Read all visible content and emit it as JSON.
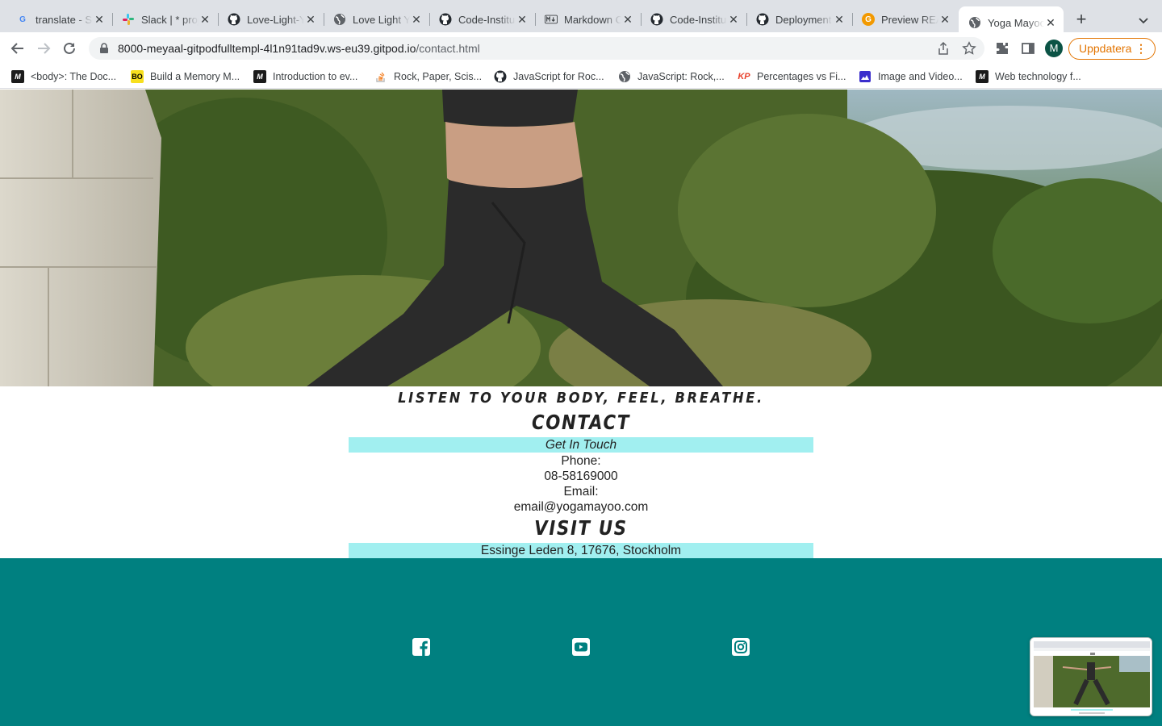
{
  "browser": {
    "tabs": [
      {
        "title": "translate - Sök på Google",
        "icon": "google-icon",
        "color": "#4285f4"
      },
      {
        "title": "Slack | * project",
        "icon": "slack-icon",
        "color": "#e01e5a"
      },
      {
        "title": "Love-Light-Yoga",
        "icon": "github-icon",
        "color": "#24292f"
      },
      {
        "title": "Love Light Yoga",
        "icon": "globe-icon",
        "color": "#5f6368"
      },
      {
        "title": "Code-Institute-Org",
        "icon": "github-icon",
        "color": "#24292f"
      },
      {
        "title": "Markdown Cheatsheet",
        "icon": "markdown-icon",
        "color": "#3c4043"
      },
      {
        "title": "Code-Institute-Solutions",
        "icon": "github-icon",
        "color": "#24292f"
      },
      {
        "title": "Deployment",
        "icon": "github-icon",
        "color": "#24292f"
      },
      {
        "title": "Preview README",
        "icon": "preview-icon",
        "color": "#f29900"
      },
      {
        "title": "Yoga Mayoo",
        "icon": "globe-icon",
        "color": "#5f6368"
      }
    ],
    "active_tab": 9,
    "url_host": "8000-meyaal-gitpodfulltempl-4l1n91tad9v.ws-eu39.gitpod.io",
    "url_path": "/contact.html",
    "profile_initial": "M",
    "update_label": "Uppdatera",
    "bookmarks": [
      {
        "label": "<body>: The Doc...",
        "icon": "mdn-icon"
      },
      {
        "label": "Build a Memory M...",
        "icon": "bo-icon"
      },
      {
        "label": "Introduction to ev...",
        "icon": "mdn-icon"
      },
      {
        "label": "Rock, Paper, Scis...",
        "icon": "stackoverflow-icon"
      },
      {
        "label": "JavaScript for Roc...",
        "icon": "github-icon"
      },
      {
        "label": "JavaScript: Rock,...",
        "icon": "globe-icon"
      },
      {
        "label": "Percentages vs Fi...",
        "icon": "kp-icon"
      },
      {
        "label": "Image and Video...",
        "icon": "imagekit-icon"
      },
      {
        "label": "Web technology f...",
        "icon": "mdn-icon"
      }
    ]
  },
  "page": {
    "slogan": "LISTEN TO YOUR BODY, FEEL, BREATHE.",
    "contact_heading": "CONTACT",
    "get_in_touch": "Get In Touch",
    "phone_label": "Phone:",
    "phone_value": "08-58169000",
    "email_label": "Email:",
    "email_value": "email@yogamayoo.com",
    "visit_heading": "VISIT US",
    "address": "Essinge Leden 8, 17676, Stockholm",
    "footer_bg": "#008080",
    "band_color": "#a1eff0",
    "social": [
      "facebook-icon",
      "youtube-icon",
      "instagram-icon"
    ]
  }
}
